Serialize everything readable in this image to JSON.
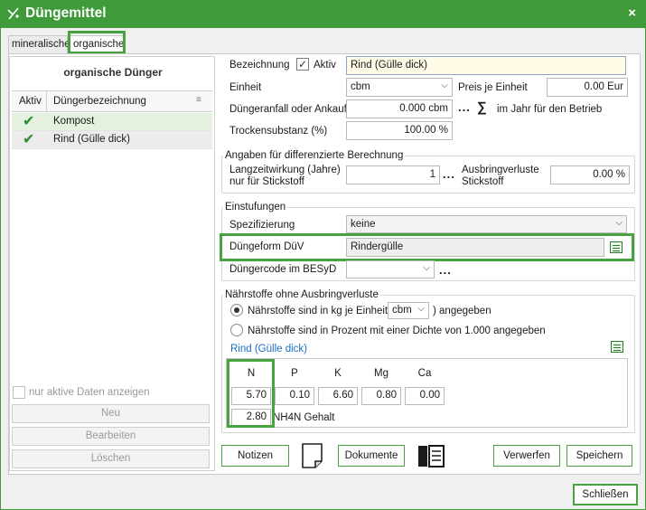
{
  "window": {
    "title": "Düngemittel",
    "close_label": "×"
  },
  "tabs": [
    {
      "label": "mineralische"
    },
    {
      "label": "organische"
    }
  ],
  "left": {
    "title": "organische Dünger",
    "columns": {
      "active": "Aktiv",
      "name": "Düngerbezeichnung"
    },
    "rows": [
      {
        "active": "✔",
        "name": "Kompost"
      },
      {
        "active": "✔",
        "name": "Rind (Gülle dick)"
      }
    ],
    "only_active_label": "nur aktive Daten anzeigen",
    "buttons": {
      "new": "Neu",
      "edit": "Bearbeiten",
      "delete": "Löschen"
    }
  },
  "form": {
    "bezeichnung_label": "Bezeichnung",
    "aktiv_label": "Aktiv",
    "bezeichnung_value": "Rind (Gülle dick)",
    "einheit_label": "Einheit",
    "einheit_value": "cbm",
    "preis_label": "Preis je Einheit",
    "preis_value": "0.00 Eur",
    "anfall_label": "Düngeranfall oder Ankauf",
    "anfall_value": "0.000 cbm",
    "anfall_dots": "...",
    "sum_symbol": "∑",
    "jahr_label": "im Jahr für den Betrieb",
    "trocken_label": "Trockensubstanz (%)",
    "trocken_value": "100.00 %"
  },
  "diff": {
    "title": "Angaben für differenzierte Berechnung",
    "langzeit_label_1": "Langzeitwirkung (Jahre)",
    "langzeit_label_2": "nur für Stickstoff",
    "langzeit_value": "1",
    "dots": "...",
    "verluste_label_1": "Ausbringverluste",
    "verluste_label_2": "Stickstoff",
    "verluste_value": "0.00 %"
  },
  "einstufungen": {
    "title": "Einstufungen",
    "spez_label": "Spezifizierung",
    "spez_value": "keine",
    "form_label": "Düngeform DüV",
    "form_value": "Rindergülle",
    "code_label": "Düngercode im BESyD",
    "code_value": "",
    "dots": "..."
  },
  "naehr": {
    "title": "Nährstoffe ohne Ausbringverluste",
    "radio1_pre": "Nährstoffe sind in kg je Einheit (",
    "radio1_unit": "cbm",
    "radio1_post": ") angegeben",
    "radio2": "Nährstoffe sind in Prozent mit einer Dichte von  1.000 angegeben",
    "link": "Rind (Gülle dick)",
    "headers": [
      "N",
      "P",
      "K",
      "Mg",
      "Ca"
    ],
    "values": [
      "5.70",
      "0.10",
      "6.60",
      "0.80",
      "0.00"
    ],
    "nh4n_value": "2.80",
    "nh4n_label": "NH4N Gehalt"
  },
  "bottom": {
    "notizen": "Notizen",
    "dokumente": "Dokumente",
    "verwerfen": "Verwerfen",
    "speichern": "Speichern",
    "schliessen": "Schließen"
  },
  "colors": {
    "accent": "#3f9b3a",
    "highlight": "#47a23f"
  }
}
